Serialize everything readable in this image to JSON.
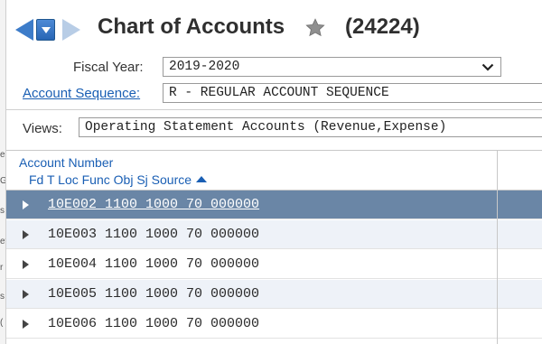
{
  "header": {
    "title": "Chart of Accounts",
    "record_count": "(24224)"
  },
  "fields": {
    "fiscal_year_label": "Fiscal Year:",
    "fiscal_year_value": "2019-2020",
    "account_sequence_label": "Account Sequence:",
    "account_sequence_value": "R - REGULAR ACCOUNT SEQUENCE",
    "views_label": "Views:",
    "views_value": "Operating Statement Accounts (Revenue,Expense)"
  },
  "grid": {
    "header_top": "Account Number",
    "header_bottom": "Fd T Loc Func Obj  Sj Source",
    "sort": "ascending",
    "rows": [
      {
        "account": "10E002 1100 1000 70 000000",
        "selected": true
      },
      {
        "account": "10E003 1100 1000 70 000000",
        "selected": false
      },
      {
        "account": "10E004 1100 1000 70 000000",
        "selected": false
      },
      {
        "account": "10E005 1100 1000 70 000000",
        "selected": false
      },
      {
        "account": "10E006 1100 1000 70 000000",
        "selected": false
      }
    ]
  },
  "left_strip_fragments": [
    "e",
    "G",
    "s",
    "et",
    "r",
    "s",
    "("
  ],
  "icons": {
    "back": "left-arrow-icon",
    "history": "dropdown-icon",
    "forward": "right-arrow-icon",
    "favorite": "star-icon",
    "select": "chevron-down-icon",
    "row": "expand-triangle-icon",
    "sort": "sort-ascending-icon"
  },
  "colors": {
    "accent_blue": "#1a5fb4",
    "selected_row": "#6a86a6",
    "alt_row": "#eef2f8"
  }
}
